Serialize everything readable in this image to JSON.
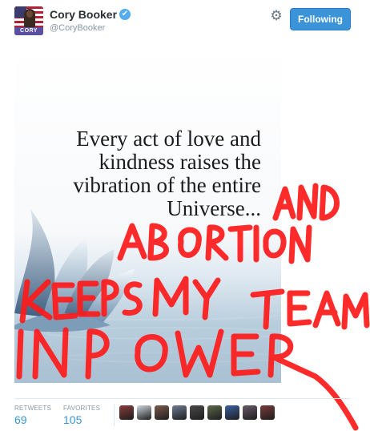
{
  "tweet": {
    "author_name": "Cory Booker",
    "handle": "@CoryBooker",
    "avatar_label": "CORY",
    "verified_icon": "✔",
    "follow_button_label": "Following",
    "media": {
      "quote_lines": [
        "Every act of love and",
        "kindness raises the",
        "vibration of the entire",
        "Universe..."
      ]
    },
    "scrawl_text": [
      "AND",
      "ABORTION",
      "KEEPS MY TEAM",
      "IN POWER"
    ],
    "stats": {
      "retweets_label": "RETWEETS",
      "retweets_value": "69",
      "favorites_label": "FAVORITES",
      "favorites_value": "105"
    },
    "favoriter_avatar_colors": [
      "#8a3b3b",
      "#cfd6dc",
      "#7c5a4a",
      "#6f7d95",
      "#4a4a4a",
      "#5a6a4a",
      "#3d5fa3",
      "#6a5a6a",
      "#7a3a3a"
    ]
  },
  "colors": {
    "follow_button": "#3b94d9",
    "stat_value": "#3b94d9",
    "scrawl": "#ff1a1a"
  }
}
